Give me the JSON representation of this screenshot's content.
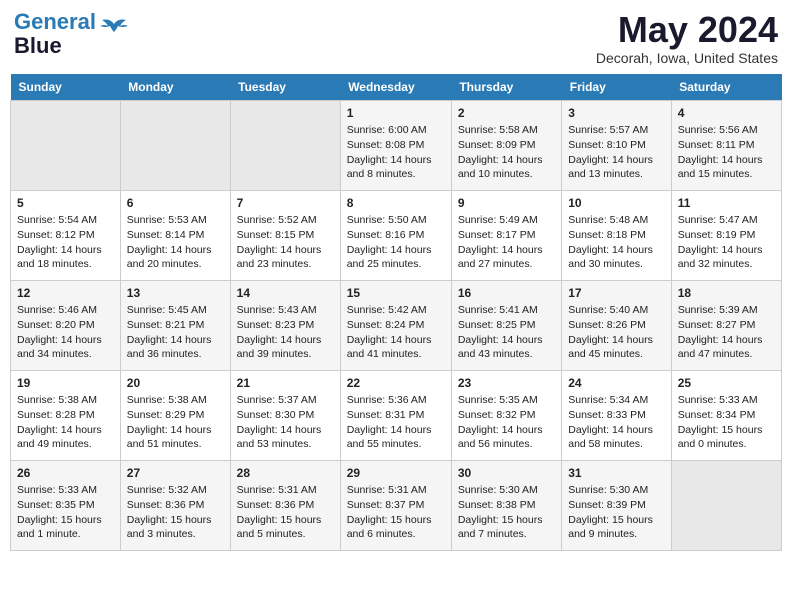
{
  "header": {
    "logo_line1": "General",
    "logo_line2": "Blue",
    "month_title": "May 2024",
    "location": "Decorah, Iowa, United States"
  },
  "days_of_week": [
    "Sunday",
    "Monday",
    "Tuesday",
    "Wednesday",
    "Thursday",
    "Friday",
    "Saturday"
  ],
  "weeks": [
    [
      {
        "day": "",
        "empty": true
      },
      {
        "day": "",
        "empty": true
      },
      {
        "day": "",
        "empty": true
      },
      {
        "day": "1",
        "sunrise": "Sunrise: 6:00 AM",
        "sunset": "Sunset: 8:08 PM",
        "daylight": "Daylight: 14 hours and 8 minutes."
      },
      {
        "day": "2",
        "sunrise": "Sunrise: 5:58 AM",
        "sunset": "Sunset: 8:09 PM",
        "daylight": "Daylight: 14 hours and 10 minutes."
      },
      {
        "day": "3",
        "sunrise": "Sunrise: 5:57 AM",
        "sunset": "Sunset: 8:10 PM",
        "daylight": "Daylight: 14 hours and 13 minutes."
      },
      {
        "day": "4",
        "sunrise": "Sunrise: 5:56 AM",
        "sunset": "Sunset: 8:11 PM",
        "daylight": "Daylight: 14 hours and 15 minutes."
      }
    ],
    [
      {
        "day": "5",
        "sunrise": "Sunrise: 5:54 AM",
        "sunset": "Sunset: 8:12 PM",
        "daylight": "Daylight: 14 hours and 18 minutes."
      },
      {
        "day": "6",
        "sunrise": "Sunrise: 5:53 AM",
        "sunset": "Sunset: 8:14 PM",
        "daylight": "Daylight: 14 hours and 20 minutes."
      },
      {
        "day": "7",
        "sunrise": "Sunrise: 5:52 AM",
        "sunset": "Sunset: 8:15 PM",
        "daylight": "Daylight: 14 hours and 23 minutes."
      },
      {
        "day": "8",
        "sunrise": "Sunrise: 5:50 AM",
        "sunset": "Sunset: 8:16 PM",
        "daylight": "Daylight: 14 hours and 25 minutes."
      },
      {
        "day": "9",
        "sunrise": "Sunrise: 5:49 AM",
        "sunset": "Sunset: 8:17 PM",
        "daylight": "Daylight: 14 hours and 27 minutes."
      },
      {
        "day": "10",
        "sunrise": "Sunrise: 5:48 AM",
        "sunset": "Sunset: 8:18 PM",
        "daylight": "Daylight: 14 hours and 30 minutes."
      },
      {
        "day": "11",
        "sunrise": "Sunrise: 5:47 AM",
        "sunset": "Sunset: 8:19 PM",
        "daylight": "Daylight: 14 hours and 32 minutes."
      }
    ],
    [
      {
        "day": "12",
        "sunrise": "Sunrise: 5:46 AM",
        "sunset": "Sunset: 8:20 PM",
        "daylight": "Daylight: 14 hours and 34 minutes."
      },
      {
        "day": "13",
        "sunrise": "Sunrise: 5:45 AM",
        "sunset": "Sunset: 8:21 PM",
        "daylight": "Daylight: 14 hours and 36 minutes."
      },
      {
        "day": "14",
        "sunrise": "Sunrise: 5:43 AM",
        "sunset": "Sunset: 8:23 PM",
        "daylight": "Daylight: 14 hours and 39 minutes."
      },
      {
        "day": "15",
        "sunrise": "Sunrise: 5:42 AM",
        "sunset": "Sunset: 8:24 PM",
        "daylight": "Daylight: 14 hours and 41 minutes."
      },
      {
        "day": "16",
        "sunrise": "Sunrise: 5:41 AM",
        "sunset": "Sunset: 8:25 PM",
        "daylight": "Daylight: 14 hours and 43 minutes."
      },
      {
        "day": "17",
        "sunrise": "Sunrise: 5:40 AM",
        "sunset": "Sunset: 8:26 PM",
        "daylight": "Daylight: 14 hours and 45 minutes."
      },
      {
        "day": "18",
        "sunrise": "Sunrise: 5:39 AM",
        "sunset": "Sunset: 8:27 PM",
        "daylight": "Daylight: 14 hours and 47 minutes."
      }
    ],
    [
      {
        "day": "19",
        "sunrise": "Sunrise: 5:38 AM",
        "sunset": "Sunset: 8:28 PM",
        "daylight": "Daylight: 14 hours and 49 minutes."
      },
      {
        "day": "20",
        "sunrise": "Sunrise: 5:38 AM",
        "sunset": "Sunset: 8:29 PM",
        "daylight": "Daylight: 14 hours and 51 minutes."
      },
      {
        "day": "21",
        "sunrise": "Sunrise: 5:37 AM",
        "sunset": "Sunset: 8:30 PM",
        "daylight": "Daylight: 14 hours and 53 minutes."
      },
      {
        "day": "22",
        "sunrise": "Sunrise: 5:36 AM",
        "sunset": "Sunset: 8:31 PM",
        "daylight": "Daylight: 14 hours and 55 minutes."
      },
      {
        "day": "23",
        "sunrise": "Sunrise: 5:35 AM",
        "sunset": "Sunset: 8:32 PM",
        "daylight": "Daylight: 14 hours and 56 minutes."
      },
      {
        "day": "24",
        "sunrise": "Sunrise: 5:34 AM",
        "sunset": "Sunset: 8:33 PM",
        "daylight": "Daylight: 14 hours and 58 minutes."
      },
      {
        "day": "25",
        "sunrise": "Sunrise: 5:33 AM",
        "sunset": "Sunset: 8:34 PM",
        "daylight": "Daylight: 15 hours and 0 minutes."
      }
    ],
    [
      {
        "day": "26",
        "sunrise": "Sunrise: 5:33 AM",
        "sunset": "Sunset: 8:35 PM",
        "daylight": "Daylight: 15 hours and 1 minute."
      },
      {
        "day": "27",
        "sunrise": "Sunrise: 5:32 AM",
        "sunset": "Sunset: 8:36 PM",
        "daylight": "Daylight: 15 hours and 3 minutes."
      },
      {
        "day": "28",
        "sunrise": "Sunrise: 5:31 AM",
        "sunset": "Sunset: 8:36 PM",
        "daylight": "Daylight: 15 hours and 5 minutes."
      },
      {
        "day": "29",
        "sunrise": "Sunrise: 5:31 AM",
        "sunset": "Sunset: 8:37 PM",
        "daylight": "Daylight: 15 hours and 6 minutes."
      },
      {
        "day": "30",
        "sunrise": "Sunrise: 5:30 AM",
        "sunset": "Sunset: 8:38 PM",
        "daylight": "Daylight: 15 hours and 7 minutes."
      },
      {
        "day": "31",
        "sunrise": "Sunrise: 5:30 AM",
        "sunset": "Sunset: 8:39 PM",
        "daylight": "Daylight: 15 hours and 9 minutes."
      },
      {
        "day": "",
        "empty": true
      }
    ]
  ]
}
